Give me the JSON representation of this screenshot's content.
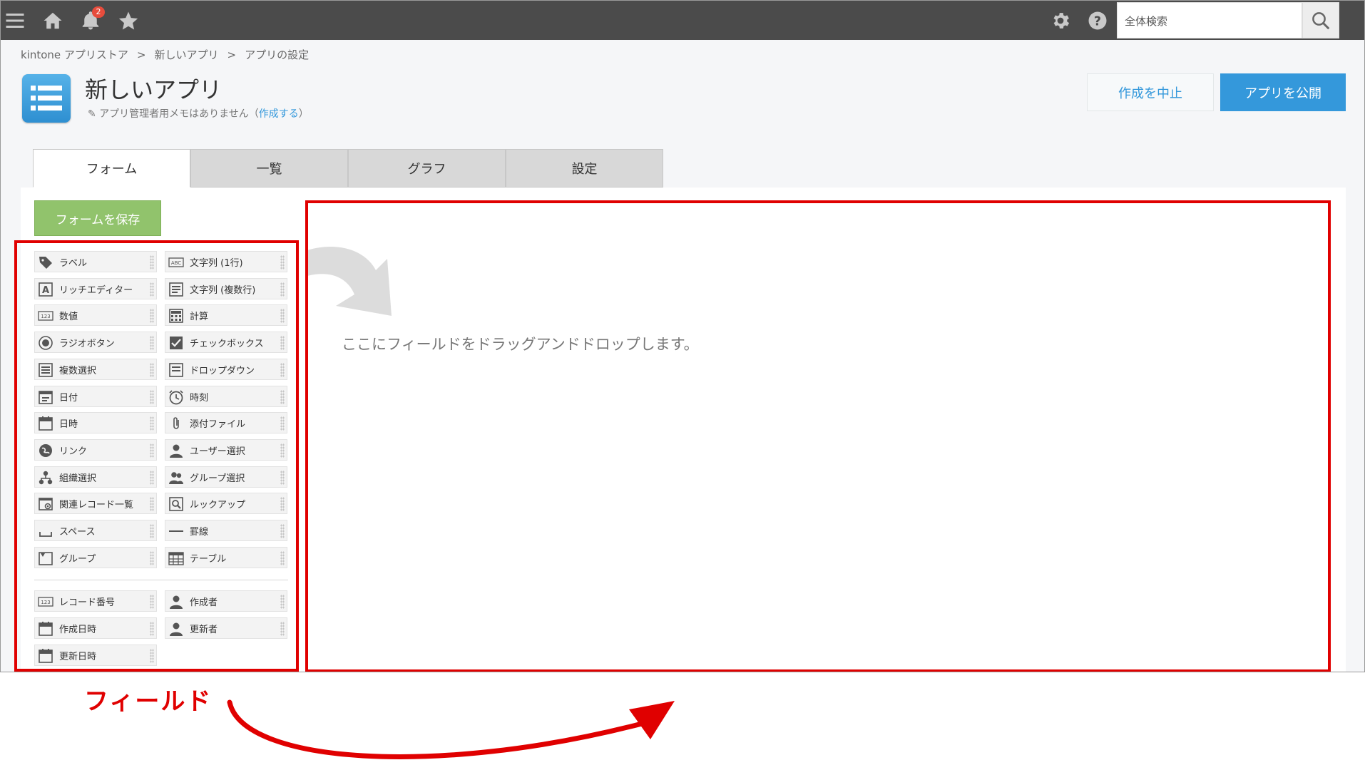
{
  "topbar": {
    "notification_count": "2",
    "search_placeholder": "全体検索",
    "icons": [
      "menu-icon",
      "home-icon",
      "bell-icon",
      "star-icon",
      "gear-icon",
      "help-icon",
      "search-icon"
    ]
  },
  "breadcrumb": [
    "kintone アプリストア",
    "新しいアプリ",
    "アプリの設定"
  ],
  "breadcrumb_sep": ">",
  "header": {
    "title": "新しいアプリ",
    "memo": "アプリ管理者用メモはありません",
    "memo_link": "作成する",
    "cancel_label": "作成を中止",
    "publish_label": "アプリを公開"
  },
  "tabs": [
    "フォーム",
    "一覧",
    "グラフ",
    "設定"
  ],
  "form": {
    "save_label": "フォームを保存",
    "drop_text": "ここにフィールドをドラッグアンドドロップします。"
  },
  "fields_left": [
    "ラベル",
    "リッチエディター",
    "数値",
    "ラジオボタン",
    "複数選択",
    "日付",
    "日時",
    "リンク",
    "組織選択",
    "関連レコード一覧",
    "スペース",
    "グループ"
  ],
  "fields_right": [
    "文字列 (1行)",
    "文字列 (複数行)",
    "計算",
    "チェックボックス",
    "ドロップダウン",
    "時刻",
    "添付ファイル",
    "ユーザー選択",
    "グループ選択",
    "ルックアップ",
    "罫線",
    "テーブル"
  ],
  "system_left": [
    "レコード番号",
    "作成日時",
    "更新日時"
  ],
  "system_right": [
    "作成者",
    "更新者"
  ],
  "annotation": {
    "label": "フィールド"
  },
  "colors": {
    "topbar": "#4b4b4b",
    "accent_blue": "#3498db",
    "save_green": "#91c36c",
    "annotation_red": "#e00000"
  }
}
